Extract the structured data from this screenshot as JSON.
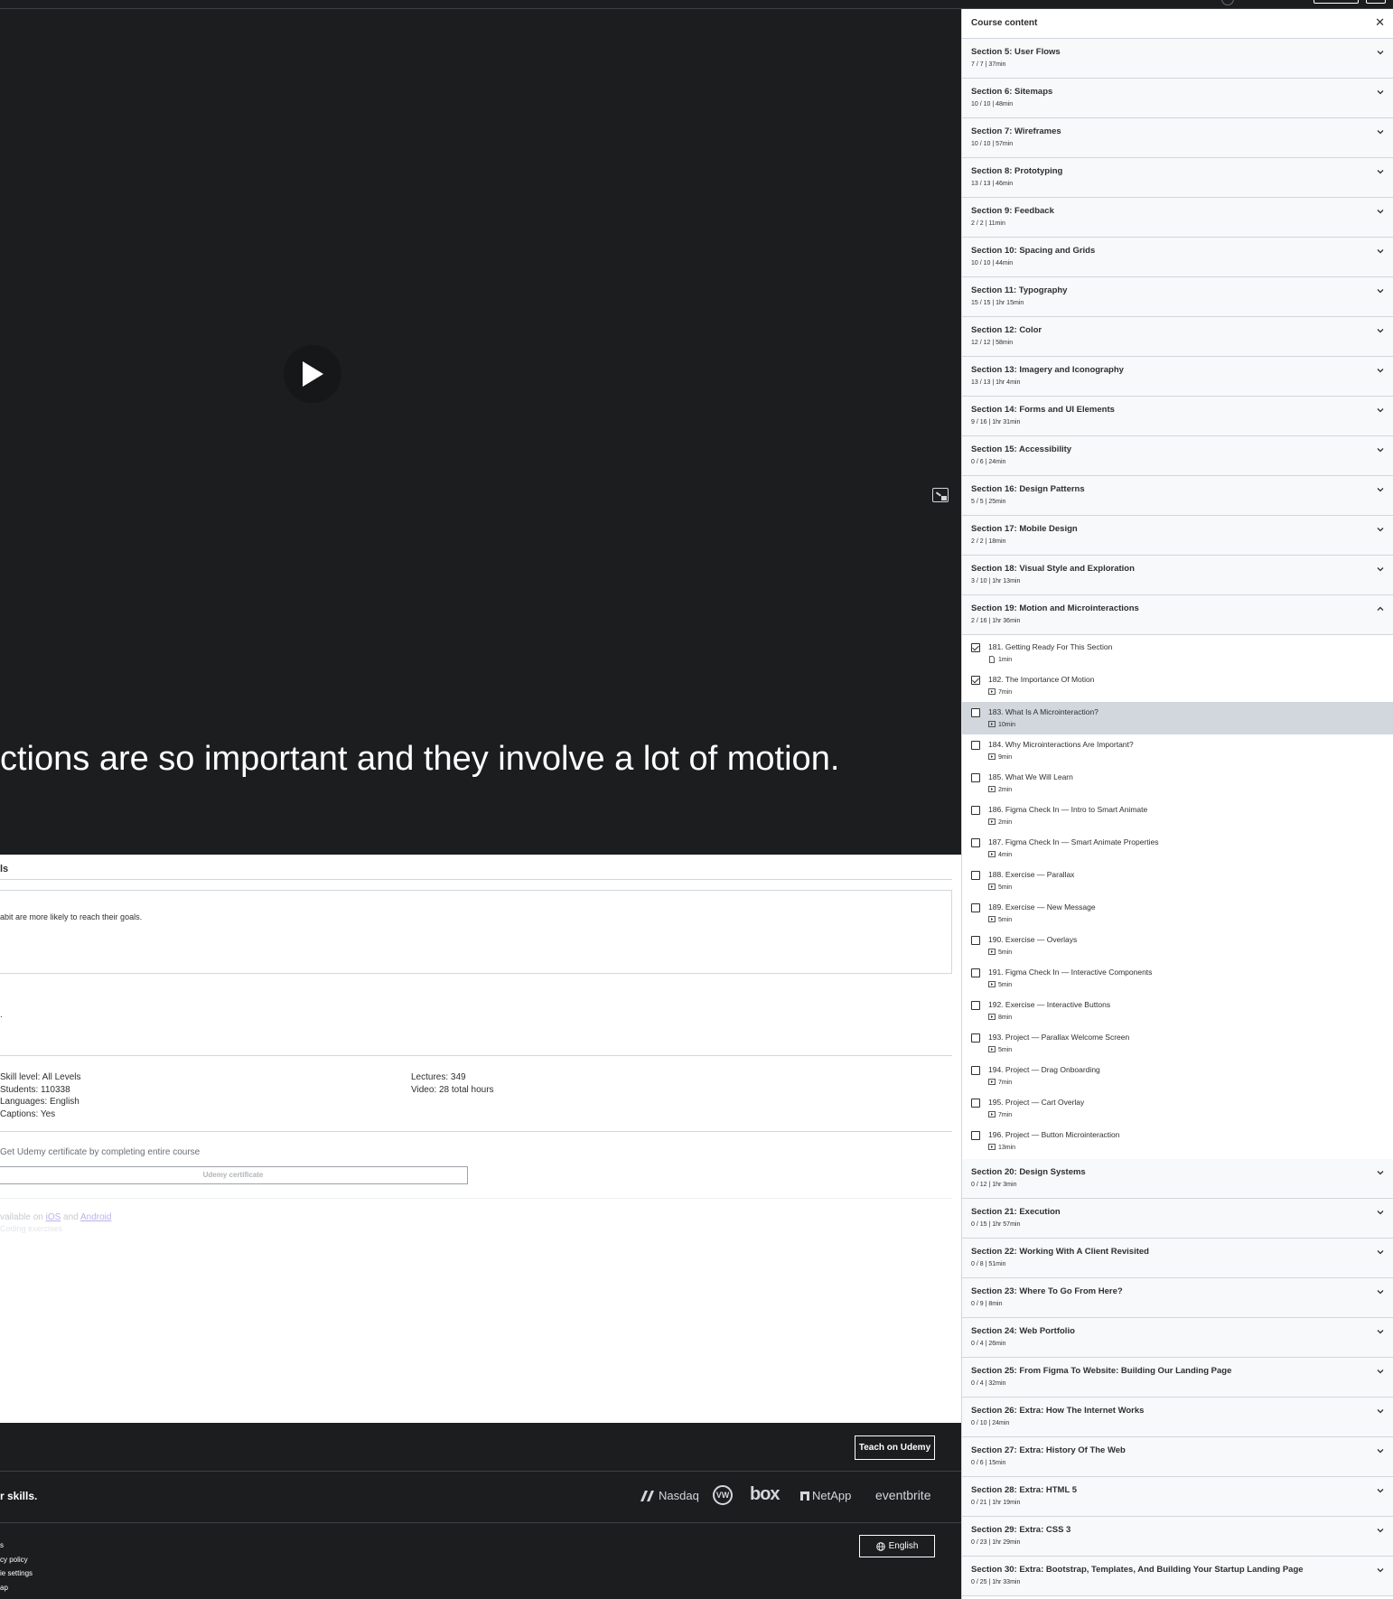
{
  "video": {
    "caption": "ctions are so important and they involve a lot of motion."
  },
  "overview": {
    "tab_fragment": "ls",
    "goal_text": "abit are more likely to reach their goals.",
    "dot": ".",
    "stats_left": [
      "Skill level: All Levels",
      "Students: 110338",
      "Languages: English",
      "Captions: Yes"
    ],
    "stats_right": [
      "Lectures: 349",
      "Video: 28 total hours"
    ],
    "cert_text": "Get Udemy certificate by completing entire course",
    "cert_button": "Udemy certificate",
    "available_prefix": "vailable on",
    "available_ios": "iOS",
    "available_and": "and",
    "available_android": "Android",
    "coding": "Coding exercises"
  },
  "footer": {
    "teach_button": "Teach on Udemy",
    "skills_text": "r skills.",
    "logos": [
      "Nasdaq",
      "VW",
      "box",
      "NetApp",
      "eventbrite"
    ],
    "language_button": "English",
    "links": [
      "s",
      "cy policy",
      "ie settings",
      "ap"
    ]
  },
  "sidebar": {
    "title": "Course content",
    "sections_before": [
      {
        "title": "Section 5: User Flows",
        "meta": "7 / 7 | 37min"
      },
      {
        "title": "Section 6: Sitemaps",
        "meta": "10 / 10 | 48min"
      },
      {
        "title": "Section 7: Wireframes",
        "meta": "10 / 10 | 57min"
      },
      {
        "title": "Section 8: Prototyping",
        "meta": "13 / 13 | 46min"
      },
      {
        "title": "Section 9: Feedback",
        "meta": "2 / 2 | 11min"
      },
      {
        "title": "Section 10: Spacing and Grids",
        "meta": "10 / 10 | 44min"
      },
      {
        "title": "Section 11: Typography",
        "meta": "15 / 15 | 1hr 15min"
      },
      {
        "title": "Section 12: Color",
        "meta": "12 / 12 | 58min"
      },
      {
        "title": "Section 13: Imagery and Iconography",
        "meta": "13 / 13 | 1hr 4min"
      },
      {
        "title": "Section 14: Forms and UI Elements",
        "meta": "9 / 16 | 1hr 31min"
      },
      {
        "title": "Section 15: Accessibility",
        "meta": "0 / 6 | 24min"
      },
      {
        "title": "Section 16: Design Patterns",
        "meta": "5 / 5 | 25min"
      },
      {
        "title": "Section 17: Mobile Design",
        "meta": "2 / 2 | 18min"
      },
      {
        "title": "Section 18: Visual Style and Exploration",
        "meta": "3 / 10 | 1hr 13min"
      },
      {
        "title": "Section 19: Motion and Microinteractions",
        "meta": "2 / 16 | 1hr 36min"
      }
    ],
    "lectures": [
      {
        "title": "181. Getting Ready For This Section",
        "meta": "1min",
        "done": true,
        "type": "doc"
      },
      {
        "title": "182. The Importance Of Motion",
        "meta": "7min",
        "done": true,
        "type": "video"
      },
      {
        "title": "183. What Is A Microinteraction?",
        "meta": "10min",
        "done": false,
        "type": "video",
        "active": true
      },
      {
        "title": "184. Why Microinteractions Are Important?",
        "meta": "9min",
        "done": false,
        "type": "video"
      },
      {
        "title": "185. What We Will Learn",
        "meta": "2min",
        "done": false,
        "type": "video"
      },
      {
        "title": "186. Figma Check In — Intro to Smart Animate",
        "meta": "2min",
        "done": false,
        "type": "video"
      },
      {
        "title": "187. Figma Check In — Smart Animate Properties",
        "meta": "4min",
        "done": false,
        "type": "video"
      },
      {
        "title": "188. Exercise — Parallax",
        "meta": "5min",
        "done": false,
        "type": "video"
      },
      {
        "title": "189. Exercise — New Message",
        "meta": "5min",
        "done": false,
        "type": "video"
      },
      {
        "title": "190. Exercise — Overlays",
        "meta": "5min",
        "done": false,
        "type": "video"
      },
      {
        "title": "191. Figma Check In — Interactive Components",
        "meta": "5min",
        "done": false,
        "type": "video"
      },
      {
        "title": "192. Exercise — Interactive Buttons",
        "meta": "8min",
        "done": false,
        "type": "video"
      },
      {
        "title": "193. Project — Parallax Welcome Screen",
        "meta": "5min",
        "done": false,
        "type": "video"
      },
      {
        "title": "194. Project — Drag Onboarding",
        "meta": "7min",
        "done": false,
        "type": "video"
      },
      {
        "title": "195. Project — Cart Overlay",
        "meta": "7min",
        "done": false,
        "type": "video"
      },
      {
        "title": "196. Project — Button Microinteraction",
        "meta": "13min",
        "done": false,
        "type": "video"
      }
    ],
    "sections_after": [
      {
        "title": "Section 20: Design Systems",
        "meta": "0 / 12 | 1hr 3min"
      },
      {
        "title": "Section 21: Execution",
        "meta": "0 / 15 | 1hr 57min"
      },
      {
        "title": "Section 22: Working With A Client Revisited",
        "meta": "0 / 8 | 51min"
      },
      {
        "title": "Section 23: Where To Go From Here?",
        "meta": "0 / 9 | 8min"
      },
      {
        "title": "Section 24: Web Portfolio",
        "meta": "0 / 4 | 26min"
      },
      {
        "title": "Section 25: From Figma To Website: Building Our Landing Page",
        "meta": "0 / 4 | 32min"
      },
      {
        "title": "Section 26: Extra: How The Internet Works",
        "meta": "0 / 10 | 24min"
      },
      {
        "title": "Section 27: Extra: History Of The Web",
        "meta": "0 / 6 | 15min"
      },
      {
        "title": "Section 28: Extra: HTML 5",
        "meta": "0 / 21 | 1hr 19min"
      },
      {
        "title": "Section 29: Extra: CSS 3",
        "meta": "0 / 23 | 1hr 29min"
      },
      {
        "title": "Section 30: Extra: Bootstrap, Templates, And Building Your Startup Landing Page",
        "meta": "0 / 25 | 1hr 33min"
      }
    ]
  }
}
